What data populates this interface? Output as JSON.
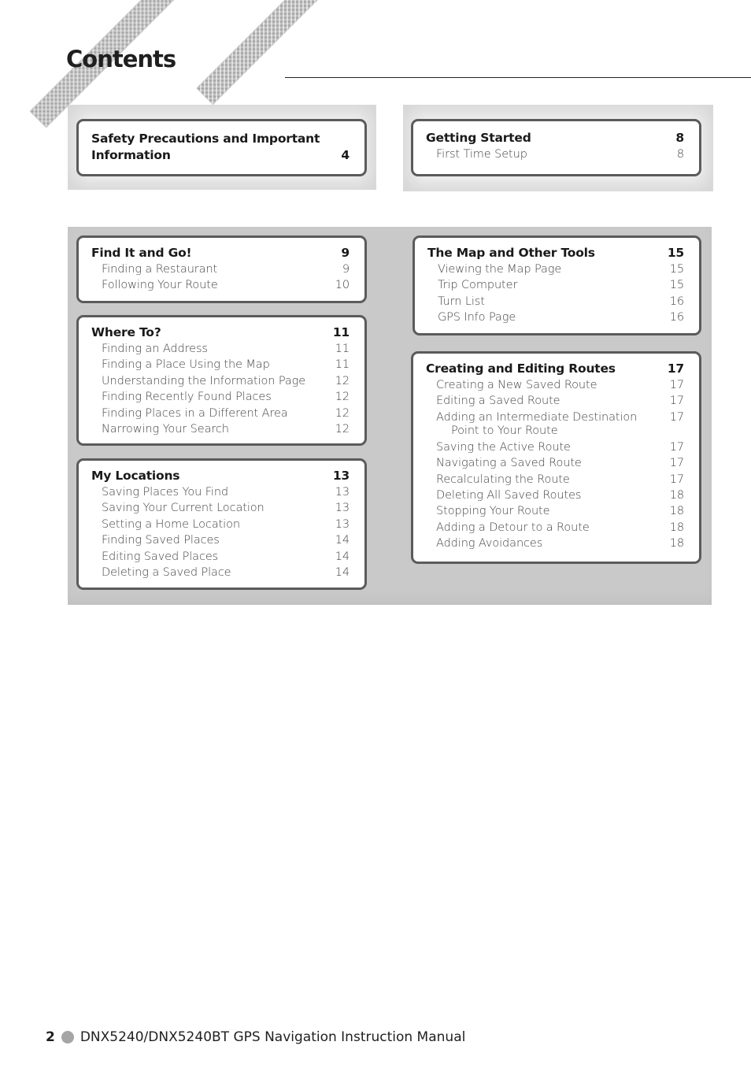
{
  "page": {
    "title": "Contents",
    "footer": {
      "page_number": "2",
      "manual_title": "DNX5240/DNX5240BT GPS Navigation Instruction Manual"
    }
  },
  "sections": {
    "safety": {
      "heading_line1": "Safety Precautions and Important",
      "heading_line2": "Information",
      "page": "4",
      "items": []
    },
    "getting_started": {
      "heading": "Getting Started",
      "page": "8",
      "items": [
        {
          "label": "First Time Setup",
          "page": "8"
        }
      ]
    },
    "find_it": {
      "heading": "Find It and Go!",
      "page": "9",
      "items": [
        {
          "label": "Finding a Restaurant",
          "page": "9"
        },
        {
          "label": "Following Your Route",
          "page": "10"
        }
      ]
    },
    "where_to": {
      "heading": "Where To?",
      "page": "11",
      "items": [
        {
          "label": "Finding an Address",
          "page": "11"
        },
        {
          "label": "Finding a Place Using the Map",
          "page": "11"
        },
        {
          "label": "Understanding the Information Page",
          "page": "12"
        },
        {
          "label": "Finding Recently Found Places",
          "page": "12"
        },
        {
          "label": "Finding Places in a Different Area",
          "page": "12"
        },
        {
          "label": "Narrowing Your Search",
          "page": "12"
        }
      ]
    },
    "my_locations": {
      "heading": "My Locations",
      "page": "13",
      "items": [
        {
          "label": "Saving Places You Find",
          "page": "13"
        },
        {
          "label": "Saving Your Current Location",
          "page": "13"
        },
        {
          "label": "Setting a Home Location",
          "page": "13"
        },
        {
          "label": "Finding Saved Places",
          "page": "14"
        },
        {
          "label": "Editing Saved Places",
          "page": "14"
        },
        {
          "label": "Deleting a Saved Place",
          "page": "14"
        }
      ]
    },
    "map_tools": {
      "heading": "The Map and Other Tools",
      "page": "15",
      "items": [
        {
          "label": "Viewing the Map Page",
          "page": "15"
        },
        {
          "label": "Trip Computer",
          "page": "15"
        },
        {
          "label": "Turn List",
          "page": "16"
        },
        {
          "label": "GPS Info Page",
          "page": "16"
        }
      ]
    },
    "routes": {
      "heading": "Creating and Editing Routes",
      "page": "17",
      "items": [
        {
          "label": "Creating a New Saved Route",
          "page": "17"
        },
        {
          "label": "Editing a Saved Route",
          "page": "17"
        },
        {
          "label": "Adding an Intermediate Destination",
          "label_cont": "Point to Your Route",
          "page": "17"
        },
        {
          "label": "Saving the Active Route",
          "page": "17"
        },
        {
          "label": "Navigating a Saved Route",
          "page": "17"
        },
        {
          "label": "Recalculating the Route",
          "page": "17"
        },
        {
          "label": "Deleting All Saved Routes",
          "page": "18"
        },
        {
          "label": "Stopping Your Route",
          "page": "18"
        },
        {
          "label": "Adding a Detour to a Route",
          "page": "18"
        },
        {
          "label": "Adding Avoidances",
          "page": "18"
        }
      ]
    }
  }
}
